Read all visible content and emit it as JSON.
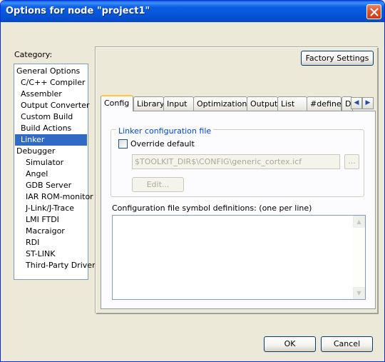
{
  "window": {
    "title": "Options for node \"project1\""
  },
  "category": {
    "label": "Category:",
    "items": [
      {
        "label": "General Options"
      },
      {
        "label": "C/C++ Compiler"
      },
      {
        "label": "Assembler"
      },
      {
        "label": "Output Converter"
      },
      {
        "label": "Custom Build"
      },
      {
        "label": "Build Actions"
      },
      {
        "label": "Linker",
        "selected": true
      },
      {
        "label": "Debugger"
      },
      {
        "label": "Simulator"
      },
      {
        "label": "Angel"
      },
      {
        "label": "GDB Server"
      },
      {
        "label": "IAR ROM-monitor"
      },
      {
        "label": "J-Link/J-Trace"
      },
      {
        "label": "LMI FTDI"
      },
      {
        "label": "Macraigor"
      },
      {
        "label": "RDI"
      },
      {
        "label": "ST-LINK"
      },
      {
        "label": "Third-Party Driver"
      }
    ]
  },
  "factory_settings_label": "Factory Settings",
  "tabs": [
    {
      "label": "Config",
      "active": true
    },
    {
      "label": "Library"
    },
    {
      "label": "Input"
    },
    {
      "label": "Optimizations"
    },
    {
      "label": "Output"
    },
    {
      "label": "List"
    },
    {
      "label": "#define"
    },
    {
      "label": "D"
    }
  ],
  "tab_scroll": {
    "left": "◀",
    "right": "▶"
  },
  "config": {
    "group_title": "Linker configuration file",
    "override_label": "Override default",
    "override_checked": false,
    "config_path": "$TOOLKIT_DIR$\\CONFIG\\generic_cortex.icf",
    "browse_label": "...",
    "edit_label": "Edit...",
    "symbol_defs_label": "Configuration file symbol definitions: (one per line)",
    "symbol_defs_value": ""
  },
  "footer": {
    "ok_label": "OK",
    "cancel_label": "Cancel"
  },
  "colors": {
    "titlebar": "#0554d8",
    "selection": "#316ac5",
    "group_title": "#0046d5"
  }
}
